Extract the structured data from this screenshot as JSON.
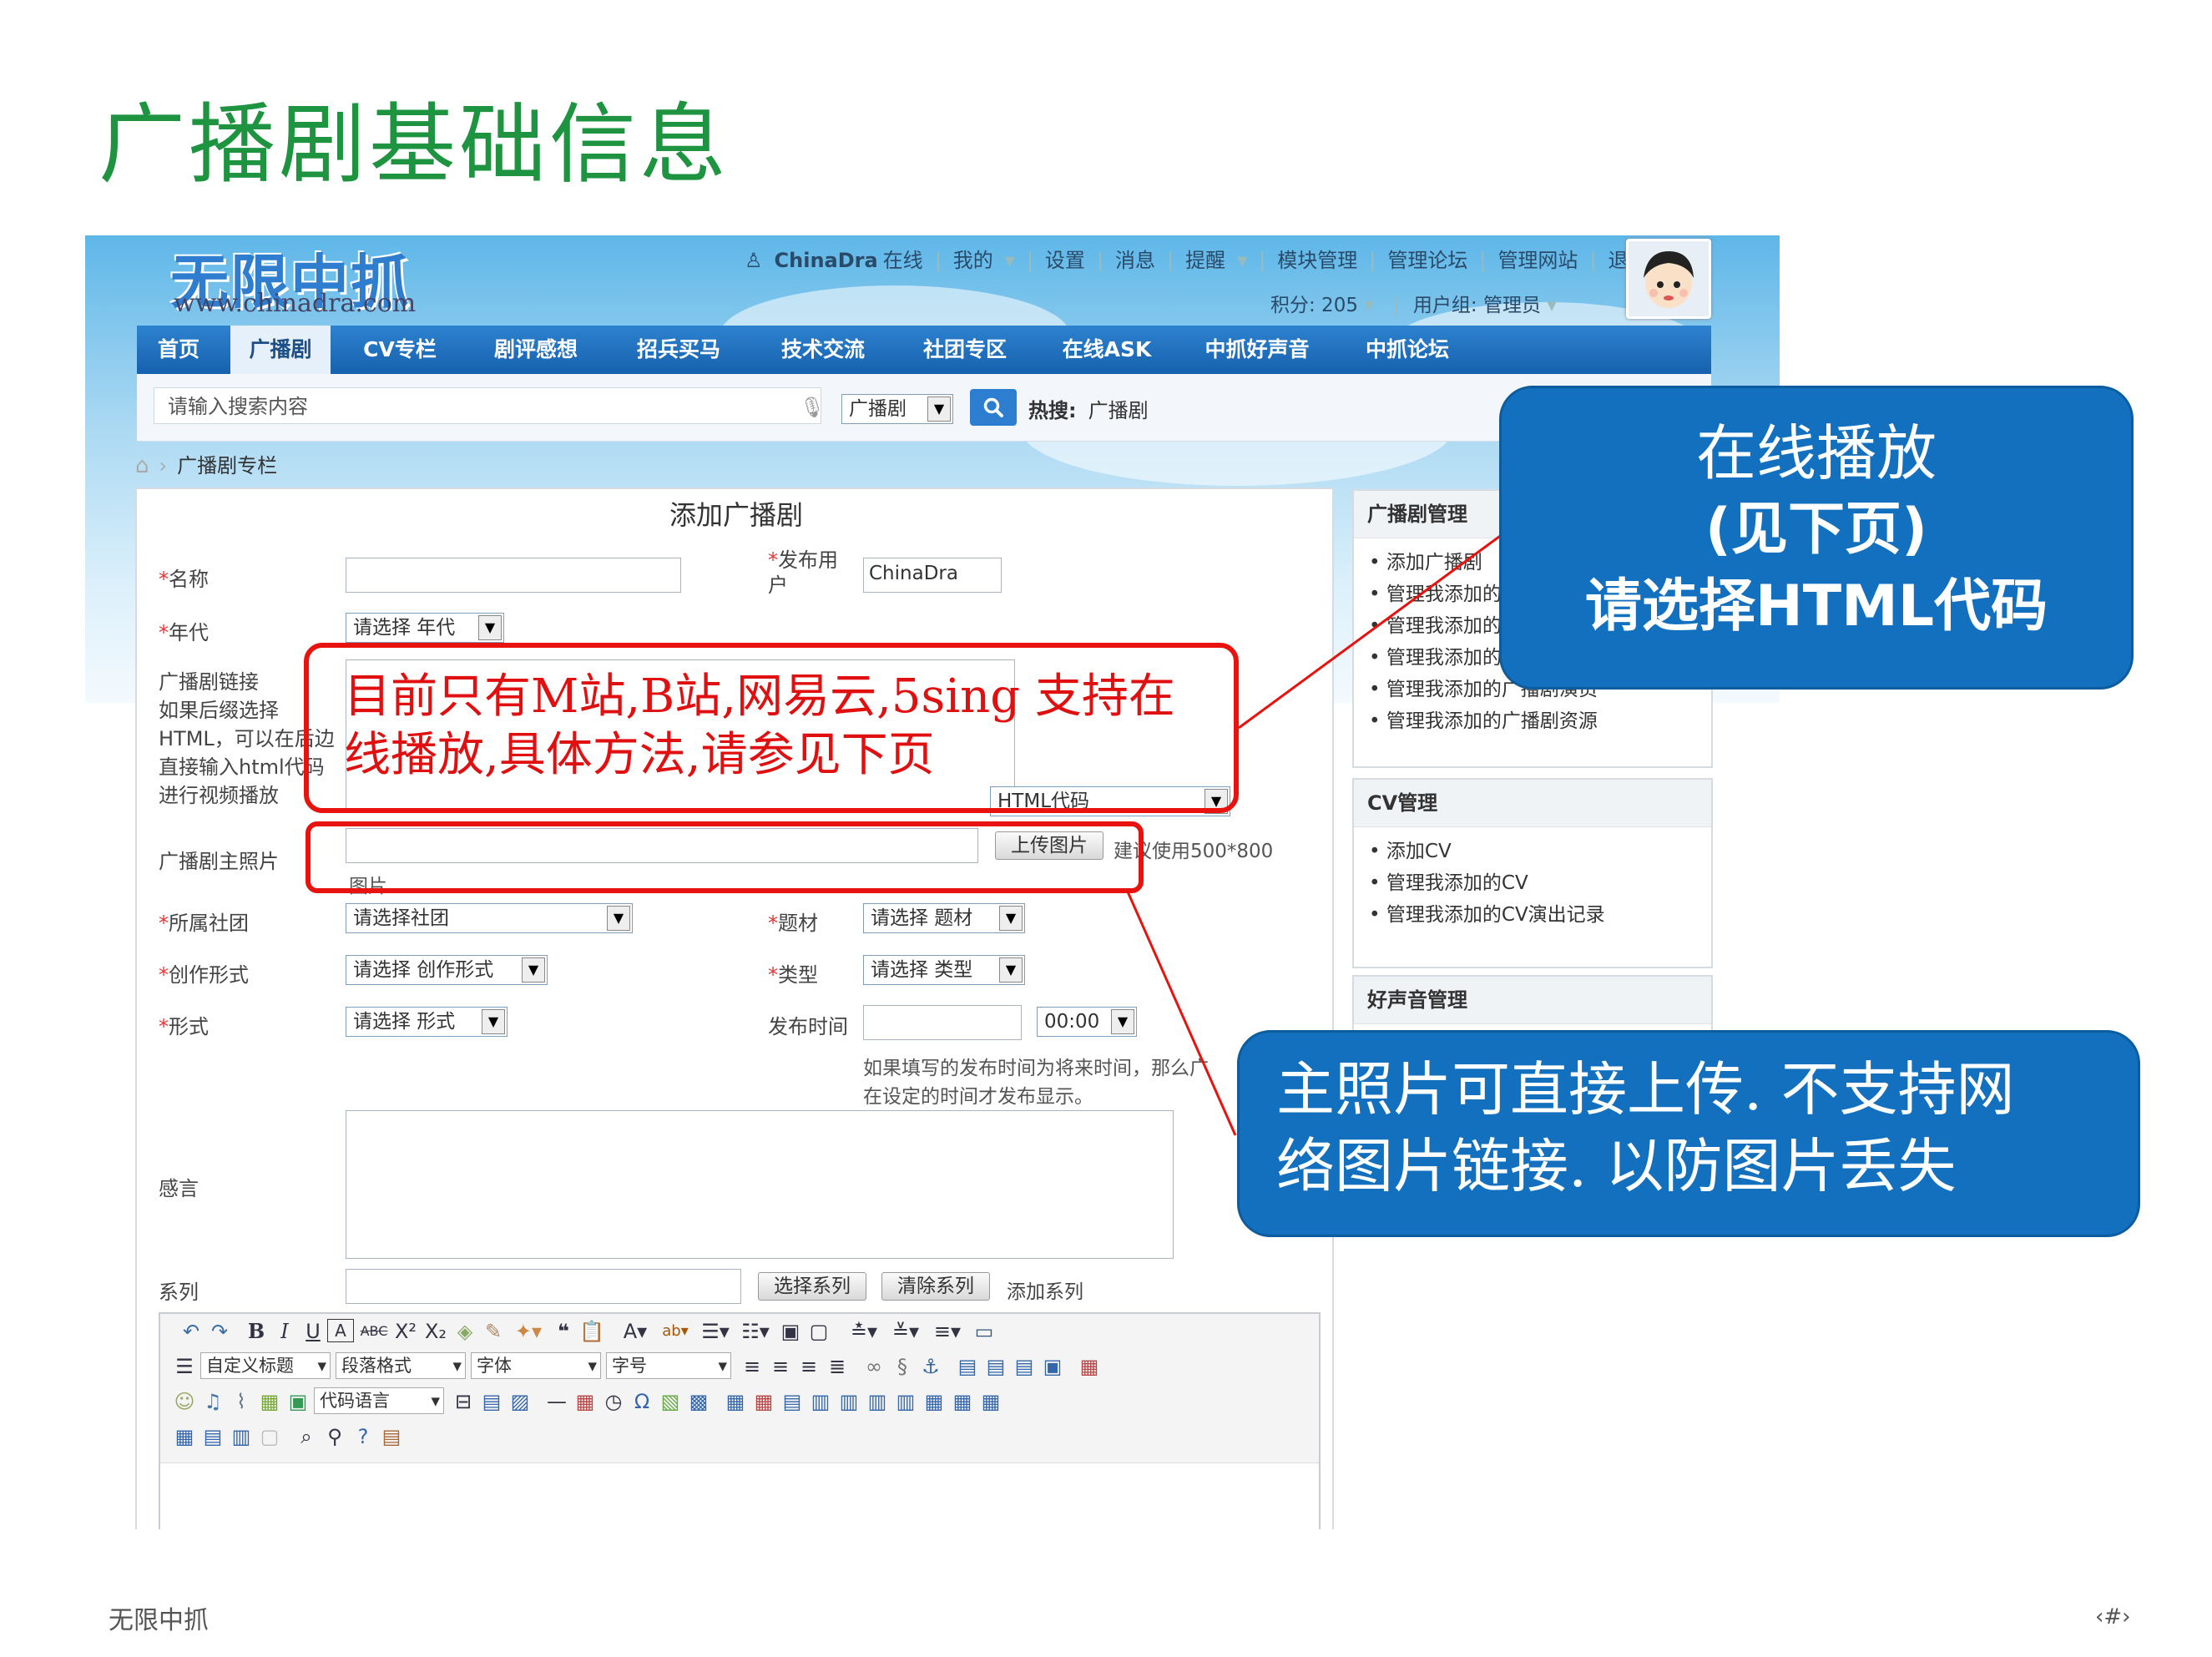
{
  "slide": {
    "title": "广播剧基础信息",
    "footer_left": "无限中抓",
    "footer_right": "‹#›"
  },
  "site": {
    "logo_text": "无限中抓",
    "logo_url": "www.chinadra.com",
    "user_name": "ChinaDra",
    "user_status": "在线",
    "top_links": [
      "我的",
      "设置",
      "消息",
      "提醒",
      "模块管理",
      "管理论坛",
      "管理网站",
      "退出"
    ],
    "points": "积分: 205",
    "user_group": "用户组: 管理员",
    "nav": [
      "首页",
      "广播剧",
      "CV专栏",
      "剧评感想",
      "招兵买马",
      "技术交流",
      "社团专区",
      "在线ASK",
      "中抓好声音",
      "中抓论坛"
    ],
    "nav_active": "广播剧",
    "search_placeholder": "请输入搜索内容",
    "search_scope": "广播剧",
    "hot_label": "热搜:",
    "hot_value": "广播剧",
    "breadcrumb": "广播剧专栏"
  },
  "form": {
    "title": "添加广播剧",
    "name_label": "名称",
    "publisher_label": "发布用户",
    "publisher_value": "ChinaDra",
    "era_label": "年代",
    "era_select": "请选择 年代",
    "link_label_lines": [
      "广播剧链接",
      "如果后缀选择",
      "HTML，可以在后边",
      "直接输入html代码",
      "进行视频播放"
    ],
    "link_type_select": "HTML代码",
    "photo_label": "广播剧主照片",
    "upload_button": "上传图片",
    "upload_hint": "建议使用500*800",
    "upload_hint_line2": "图片",
    "club_label": "所属社团",
    "club_select": "请选择社团",
    "theme_label": "题材",
    "theme_select": "请选择 题材",
    "creation_label": "创作形式",
    "creation_select": "请选择 创作形式",
    "type_label": "类型",
    "type_select": "请选择 类型",
    "form_label": "形式",
    "form_select": "请选择 形式",
    "publish_time_label": "发布时间",
    "publish_time_value": "00:00",
    "publish_hint_line1": "如果填写的发布时间为将来时间，那么广",
    "publish_hint_line2": "在设定的时间才发布显示。",
    "feedback_label": "感言",
    "series_label": "系列",
    "select_series_button": "选择系列",
    "clear_series_button": "清除系列",
    "add_series_link": "添加系列",
    "editor": {
      "custom_title": "自定义标题",
      "paragraph_format": "段落格式",
      "font_family": "字体",
      "font_size": "字号",
      "code_language": "代码语言"
    }
  },
  "sidebar": {
    "sections": [
      {
        "title": "广播剧管理",
        "items": [
          "添加广播剧",
          "管理我添加的",
          "管理我添加的",
          "管理我添加的",
          "管理我添加的广播剧演员",
          "管理我添加的广播剧资源"
        ]
      },
      {
        "title": "CV管理",
        "items": [
          "添加CV",
          "管理我添加的CV",
          "管理我添加的CV演出记录"
        ]
      },
      {
        "title": "好声音管理",
        "items": []
      }
    ]
  },
  "annotations": {
    "red_note": "目前只有M站,B站,网易云,5sing 支持在线播放,具体方法,请参见下页",
    "red_note_line1": "目前只有M站,B站,网易云,5sing 支持在",
    "red_note_line2": "线播放,具体方法,请参见下页",
    "callout_top_line1": "在线播放",
    "callout_top_line2": "(见下页)",
    "callout_top_line3": "请选择HTML代码",
    "callout_bottom_line1": "主照片可直接上传. 不支持网",
    "callout_bottom_line2": "络图片链接. 以防图片丢失"
  },
  "colors": {
    "title_green": "#1e9440",
    "callout_blue": "#1270be",
    "highlight_red": "#e8120e",
    "nav_blue": "#1d6fbf"
  }
}
